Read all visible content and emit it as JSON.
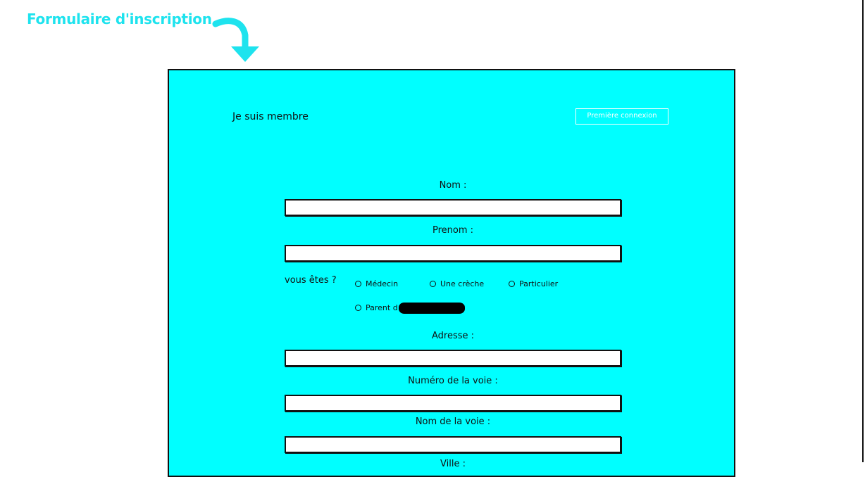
{
  "header": {
    "title": "Formulaire d'inscription"
  },
  "panel": {
    "member_label": "Je suis membre",
    "first_login_button": "Première connexion"
  },
  "form": {
    "nom_label": "Nom :",
    "nom_value": "",
    "prenom_label": "Prenom :",
    "prenom_value": "",
    "type_question": "vous êtes ?",
    "type_options": [
      "Médecin",
      "Une crèche",
      "Particulier",
      "Parent d"
    ],
    "adresse_label": "Adresse :",
    "adresse_value": "",
    "numero_voie_label": "Numéro de la voie :",
    "numero_voie_value": "",
    "nom_voie_label": "Nom de la voie :",
    "nom_voie_value": "",
    "ville_label": "Ville :"
  },
  "colors": {
    "panel_bg": "#00ffff",
    "title_color": "#1ee3ee",
    "border": "#111111"
  },
  "icons": {
    "title_arrow": "curved-arrow-down-icon"
  }
}
